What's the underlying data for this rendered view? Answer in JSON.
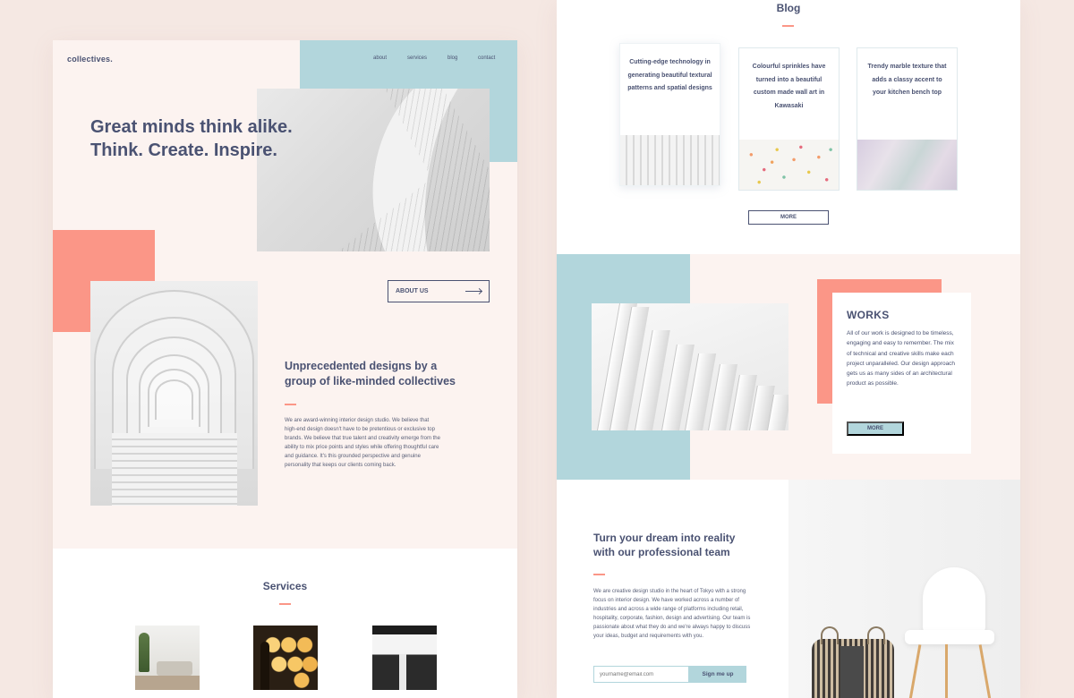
{
  "left_page": {
    "logo": "collectives.",
    "nav": [
      "about",
      "services",
      "blog",
      "contact"
    ],
    "hero_title_line1": "Great minds think alike.",
    "hero_title_line2": "Think. Create. Inspire.",
    "about_button": "ABOUT US",
    "subtitle_line1": "Unprecedented designs by a",
    "subtitle_line2": "group of like-minded collectives",
    "body": "We are award-winning interior design studio. We believe that high-end design doesn't have to be pretentious or exclusive top brands. We believe that true talent and creativity emerge from the ability to mix price points and styles while offering thoughtful care and guidance. It's this grounded perspective and genuine personality that keeps our clients coming back.",
    "services_title": "Services"
  },
  "right_page": {
    "blog_title": "Blog",
    "cards": [
      "Cutting-edge technology in generating beautiful textural patterns and spatial designs",
      "Colourful sprinkles have turned into a beautiful custom made wall art in Kawasaki",
      "Trendy marble texture that adds a classy accent to your kitchen bench top"
    ],
    "blog_more": "MORE",
    "works_title": "WORKS",
    "works_text": "All of our work is designed to be timeless, engaging and easy to remember. The mix of technical and creative skills make each project unparalleled. Our design approach gets us as many sides of an architectural product as possible.",
    "works_more": "MORE",
    "dream_title_line1": "Turn your dream into reality",
    "dream_title_line2": "with our professional team",
    "dream_body": "We are creative design studio in the heart of Tokyo with a strong focus on interior design. We have worked across a number of industries and across a wide range of platforms including retail, hospitality, corporate, fashion, design and advertising. Our team is passionate about what they do and we're always happy to discuss your ideas, budget and requirements with you.",
    "email_placeholder": "yourname@email.com",
    "signup_button": "Sign me up"
  },
  "colors": {
    "navy": "#4a5272",
    "teal": "#b2d6dc",
    "coral": "#fb9687",
    "blush": "#fcf3f0",
    "background": "#f5e8e3"
  },
  "icons": [
    "arrow-right-icon"
  ]
}
